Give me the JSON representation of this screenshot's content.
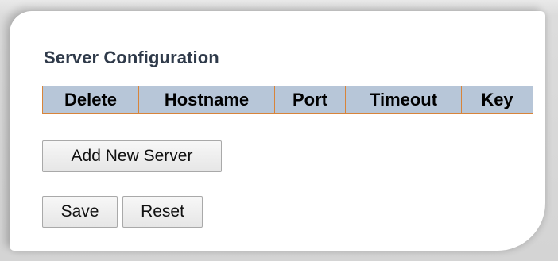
{
  "section": {
    "title": "Server Configuration"
  },
  "table": {
    "columns": [
      "Delete",
      "Hostname",
      "Port",
      "Timeout",
      "Key"
    ],
    "rows": []
  },
  "buttons": {
    "add_new_server": "Add New Server",
    "save": "Save",
    "reset": "Reset"
  },
  "colors": {
    "header_background": "#b7c6d8",
    "header_border": "#d8843a",
    "title_text": "#2f3a4a"
  }
}
